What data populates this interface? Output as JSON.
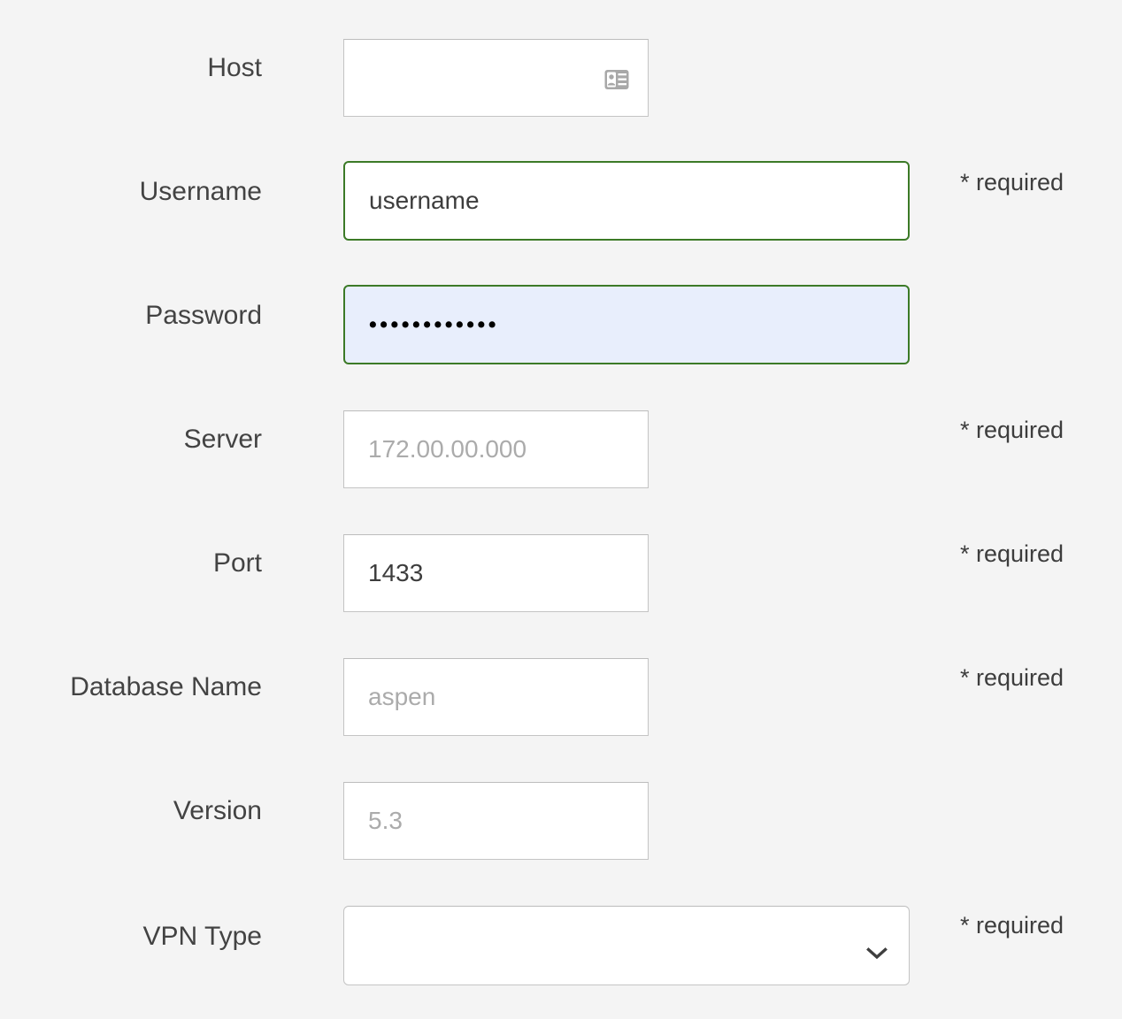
{
  "form": {
    "required_note": "* required",
    "fields": [
      {
        "key": "host",
        "label": "Host",
        "value": "",
        "placeholder": "",
        "required_text": "",
        "icon": "contact-card-icon",
        "state": "default",
        "type": "text"
      },
      {
        "key": "username",
        "label": "Username",
        "value": "username",
        "placeholder": "",
        "required_text": "* required",
        "icon": "",
        "state": "valid",
        "type": "text"
      },
      {
        "key": "password",
        "label": "Password",
        "value": "••••••••••••",
        "placeholder": "",
        "required_text": "",
        "icon": "",
        "state": "valid-autofill",
        "type": "password"
      },
      {
        "key": "server",
        "label": "Server",
        "value": "",
        "placeholder": "172.00.00.000",
        "required_text": "* required",
        "icon": "",
        "state": "default",
        "type": "text"
      },
      {
        "key": "port",
        "label": "Port",
        "value": "1433",
        "placeholder": "",
        "required_text": "* required",
        "icon": "",
        "state": "default",
        "type": "text"
      },
      {
        "key": "database_name",
        "label": "Database Name",
        "value": "",
        "placeholder": "aspen",
        "required_text": "* required",
        "icon": "",
        "state": "default",
        "type": "text"
      },
      {
        "key": "version",
        "label": "Version",
        "value": "",
        "placeholder": "5.3",
        "required_text": "",
        "icon": "",
        "state": "default",
        "type": "text"
      },
      {
        "key": "vpn_type",
        "label": "VPN Type",
        "value": "",
        "placeholder": "",
        "required_text": "* required",
        "icon": "chevron-down-icon",
        "state": "default",
        "type": "select"
      }
    ]
  },
  "colors": {
    "page_background": "#f4f4f4",
    "field_border": "#c4c4c4",
    "valid_border": "#3c7a27",
    "autofill_background": "#e8eefc",
    "label_text": "#434343",
    "value_text": "#3d3d3d",
    "placeholder_text": "#ababab",
    "icon_gray": "#a8a8a8",
    "chevron": "#3f3f3f"
  }
}
